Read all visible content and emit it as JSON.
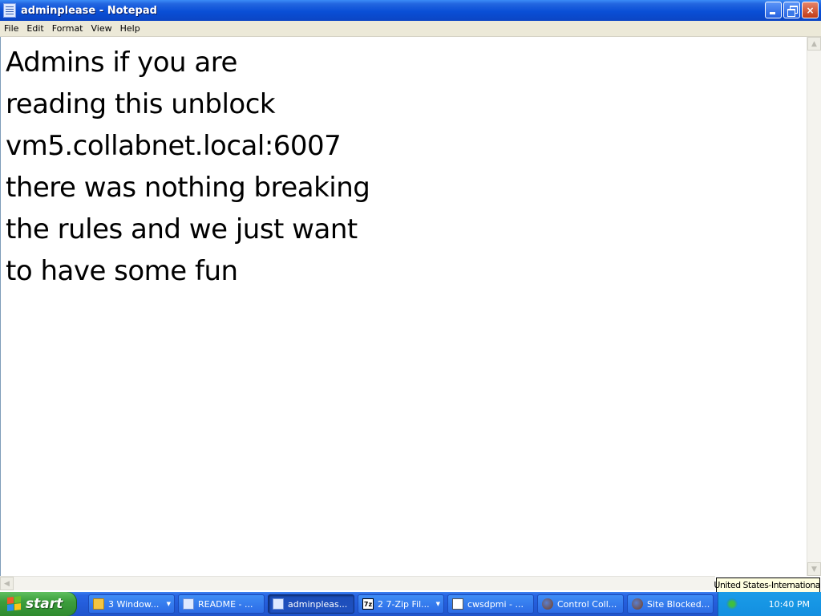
{
  "window": {
    "title": "adminplease - Notepad",
    "buttons": {
      "minimize": "minimize",
      "maximize": "restore",
      "close": "×"
    }
  },
  "menubar": {
    "items": [
      "File",
      "Edit",
      "Format",
      "View",
      "Help"
    ]
  },
  "editor": {
    "content": "Admins if you are\nreading this unblock\nvm5.collabnet.local:6007\nthere was nothing breaking\nthe rules and we just want\nto have some fun"
  },
  "tooltip": {
    "text": "United States-International"
  },
  "taskbar": {
    "start_label": "start",
    "tasks": [
      {
        "label": "3 Window...",
        "icon": "folder-icon",
        "has_dropdown": true
      },
      {
        "label": "README - ...",
        "icon": "notepad-icon",
        "has_dropdown": false
      },
      {
        "label": "adminpleas...",
        "icon": "notepad-icon",
        "active": true,
        "has_dropdown": false
      },
      {
        "label": "2 7-Zip Fil...",
        "icon": "7zip-icon",
        "has_dropdown": true
      },
      {
        "label": "cwsdpmi - ...",
        "icon": "document-icon",
        "has_dropdown": false
      },
      {
        "label": "Control Coll...",
        "icon": "firefox-icon",
        "has_dropdown": false
      },
      {
        "label": "Site Blocked...",
        "icon": "firefox-icon",
        "has_dropdown": false
      }
    ],
    "clock": "10:40 PM"
  },
  "colors": {
    "titlebar": "#0a4fd6",
    "taskbar": "#245ddb",
    "start_button": "#3c9e3c",
    "tray": "#138fe0",
    "menubar": "#ece9d8"
  }
}
